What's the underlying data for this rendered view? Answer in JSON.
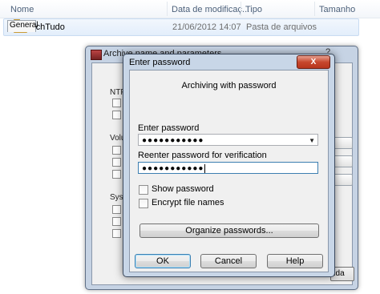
{
  "explorer": {
    "columns": [
      "Nome",
      "Data de modificaç...",
      "Tipo",
      "Tamanho"
    ],
    "rows": [
      {
        "name": "TechTudo",
        "date": "21/06/2012 14:07",
        "type": "Pasta de arquivos",
        "size": ""
      }
    ]
  },
  "back_window": {
    "title": "Archive name and parameters",
    "help": "?",
    "tab": "General",
    "labels": {
      "ntfs": "NTF",
      "volume": "Volu",
      "system": "Syst"
    },
    "bottom_button": "uda"
  },
  "dialog": {
    "title": "Enter password",
    "close_label": "X",
    "heading": "Archiving with password",
    "password_label": "Enter password",
    "password_value": "●●●●●●●●●●●",
    "reenter_label": "Reenter password for verification",
    "reenter_value": "●●●●●●●●●●●",
    "show_password_label": "Show password",
    "encrypt_names_label": "Encrypt file names",
    "organize_button": "Organize passwords...",
    "ok_button": "OK",
    "cancel_button": "Cancel",
    "help_button": "Help"
  },
  "icons": {
    "folder": "folder-icon",
    "app": "winrar-icon",
    "dropdown": "chevron-down-icon"
  },
  "colors": {
    "close_button": "#c7472d",
    "focus_border": "#3c7fb1",
    "selection_row": "#e3eefb"
  }
}
